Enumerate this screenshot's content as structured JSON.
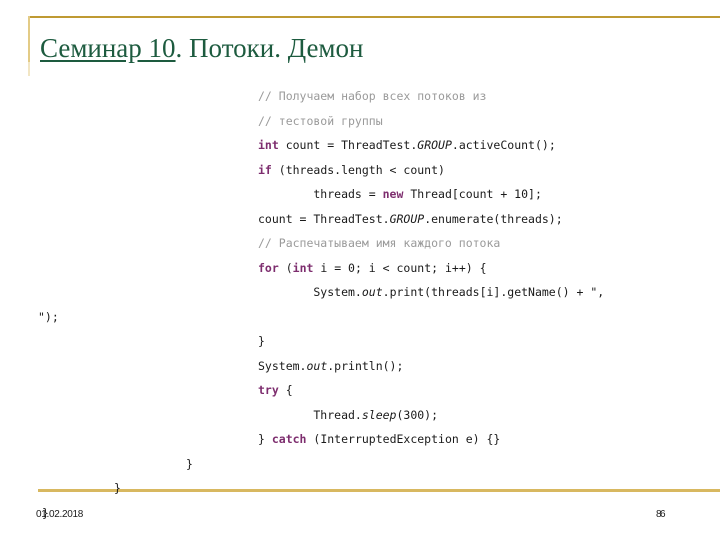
{
  "slide": {
    "title_underlined": "Семинар 10",
    "title_rest": ". Потоки. Демон",
    "accent_color": "#bf9a32",
    "title_color": "#1d5b3f",
    "comment_color": "#9a9a9a",
    "keyword_color": "#7d2d6e"
  },
  "code": {
    "lines": [
      {
        "indent": "pad",
        "segments": [
          {
            "style": "cmt",
            "text": "// Получаем набор всех потоков из"
          }
        ]
      },
      {
        "indent": "pad",
        "segments": [
          {
            "style": "cmt",
            "text": "// тестовой группы"
          }
        ]
      },
      {
        "indent": "pad",
        "segments": [
          {
            "style": "kw",
            "text": "int"
          },
          {
            "style": "pln",
            "text": " count = ThreadTest."
          },
          {
            "style": "itl",
            "text": "GROUP"
          },
          {
            "style": "pln",
            "text": ".activeCount();"
          }
        ]
      },
      {
        "indent": "pad",
        "segments": [
          {
            "style": "kw",
            "text": "if"
          },
          {
            "style": "pln",
            "text": " (threads.length < count)"
          }
        ]
      },
      {
        "indent": "pad",
        "segments": [
          {
            "style": "pln",
            "text": "        threads = "
          },
          {
            "style": "kw",
            "text": "new"
          },
          {
            "style": "pln",
            "text": " Thread[count + 10];"
          }
        ]
      },
      {
        "indent": "pad",
        "segments": [
          {
            "style": "pln",
            "text": "count = ThreadTest."
          },
          {
            "style": "itl",
            "text": "GROUP"
          },
          {
            "style": "pln",
            "text": ".enumerate(threads);"
          }
        ]
      },
      {
        "indent": "pad",
        "segments": [
          {
            "style": "cmt",
            "text": "// Распечатываем имя каждого потока"
          }
        ]
      },
      {
        "indent": "pad",
        "segments": [
          {
            "style": "kw",
            "text": "for"
          },
          {
            "style": "pln",
            "text": " ("
          },
          {
            "style": "kw",
            "text": "int"
          },
          {
            "style": "pln",
            "text": " i = 0; i < count; i++) {"
          }
        ]
      },
      {
        "indent": "pad",
        "segments": [
          {
            "style": "pln",
            "text": "        System."
          },
          {
            "style": "itl",
            "text": "out"
          },
          {
            "style": "pln",
            "text": ".print(threads[i].getName() + \", "
          }
        ]
      },
      {
        "indent": "flush",
        "segments": [
          {
            "style": "pln",
            "text": "\");"
          }
        ]
      },
      {
        "indent": "pad",
        "segments": [
          {
            "style": "pln",
            "text": "}"
          }
        ]
      },
      {
        "indent": "pad",
        "segments": [
          {
            "style": "pln",
            "text": "System."
          },
          {
            "style": "itl",
            "text": "out"
          },
          {
            "style": "pln",
            "text": ".println();"
          }
        ]
      },
      {
        "indent": "pad",
        "segments": [
          {
            "style": "kw",
            "text": "try"
          },
          {
            "style": "pln",
            "text": " {"
          }
        ]
      },
      {
        "indent": "pad",
        "segments": [
          {
            "style": "pln",
            "text": "        Thread."
          },
          {
            "style": "itl",
            "text": "sleep"
          },
          {
            "style": "pln",
            "text": "(300);"
          }
        ]
      },
      {
        "indent": "pad",
        "segments": [
          {
            "style": "pln",
            "text": "} "
          },
          {
            "style": "kw",
            "text": "catch"
          },
          {
            "style": "pln",
            "text": " (InterruptedException e) {}"
          }
        ]
      },
      {
        "indent": "brace1",
        "segments": [
          {
            "style": "pln",
            "text": "}"
          }
        ]
      },
      {
        "indent": "brace2",
        "segments": [
          {
            "style": "pln",
            "text": "}"
          }
        ]
      },
      {
        "indent": "brace3",
        "segments": [
          {
            "style": "pln",
            "text": "}"
          }
        ]
      }
    ]
  },
  "footer": {
    "date": "01.02.2018",
    "page_number": "86"
  }
}
